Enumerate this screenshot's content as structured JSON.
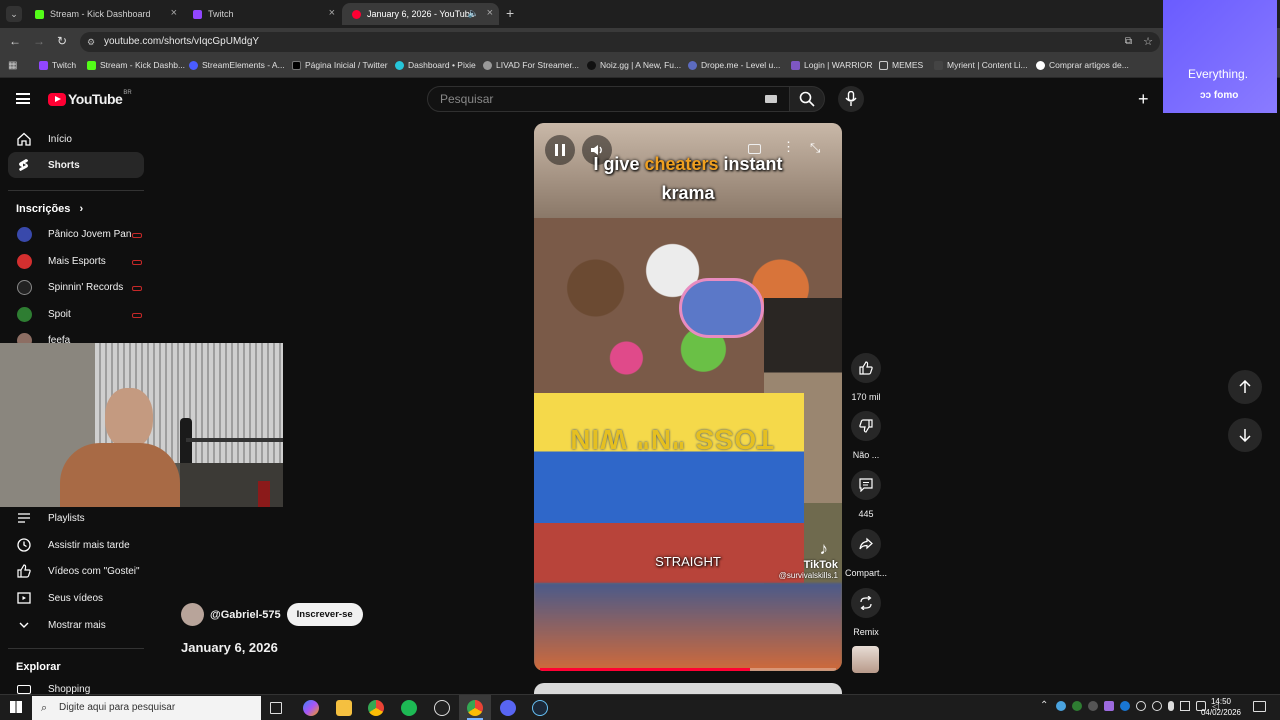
{
  "browser": {
    "tabs": [
      {
        "label": "Stream - Kick Dashboard",
        "color": "#53fc18"
      },
      {
        "label": "Twitch",
        "color": "#9146ff"
      },
      {
        "label": "January 6, 2026 - YouTube",
        "color": "#ff0033"
      }
    ],
    "url": "youtube.com/shorts/vIqcGpUMdgY",
    "bookmarks": [
      "Twitch",
      "Stream - Kick Dashb...",
      "StreamElements - A...",
      "Página Inicial / Twitter",
      "Dashboard • Pixie",
      "LIVAD For Streamer...",
      "Noiz.gg | A New, Fu...",
      "Drope.me - Level u...",
      "Login | WARRIOR",
      "MEMES",
      "Myrient | Content Li...",
      "Comprar artigos de..."
    ]
  },
  "ad": {
    "tagline": "Everything.",
    "brand": "fomo"
  },
  "youtube": {
    "logo": "YouTube",
    "region": "BR",
    "search_placeholder": "Pesquisar"
  },
  "sidebar": {
    "home": "Início",
    "shorts": "Shorts",
    "subs_title": "Inscrições",
    "subs": [
      {
        "name": "Pânico Jovem Pan",
        "color": "#3949ab"
      },
      {
        "name": "Mais Esports",
        "color": "#d32f2f"
      },
      {
        "name": "Spinnin' Records",
        "color": "#222222"
      },
      {
        "name": "Spoit",
        "color": "#2e7d32"
      },
      {
        "name": "feefa",
        "color": "#8d6e63"
      }
    ],
    "playlists": "Playlists",
    "watch_later": "Assistir mais tarde",
    "liked": "Vídeos com \"Gostei\"",
    "your_videos": "Seus vídeos",
    "show_more": "Mostrar mais",
    "explore_title": "Explorar",
    "shopping": "Shopping"
  },
  "video": {
    "caption_line1_a": "I give ",
    "caption_line1_b": "cheaters",
    "caption_line1_c": " instant",
    "caption_line2": "krama",
    "sign_text": "TOSS \"N\" WIN",
    "subtitle": "STRAIGHT",
    "watermark_brand": "TikTok",
    "watermark_handle": "@survivalskills.1",
    "progress": 0.71
  },
  "actions": {
    "likes": "170 mil",
    "dislike": "Não ...",
    "comments": "445",
    "share": "Compart...",
    "remix": "Remix"
  },
  "channel": {
    "handle": "@Gabriel-575",
    "subscribe": "Inscrever-se",
    "video_title": "January 6, 2026"
  },
  "taskbar": {
    "search_placeholder": "Digite aqui para pesquisar",
    "time": "14:50",
    "date": "04/02/2026"
  }
}
